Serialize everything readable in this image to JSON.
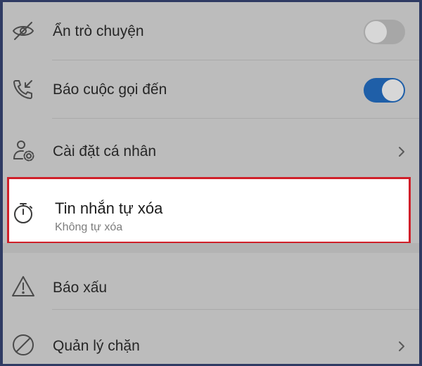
{
  "settings": {
    "items": [
      {
        "icon": "eye-off-icon",
        "label": "Ẩn trò chuyện",
        "control": "toggle",
        "toggle_on": false
      },
      {
        "icon": "incoming-call-icon",
        "label": "Báo cuộc gọi đến",
        "control": "toggle",
        "toggle_on": true
      },
      {
        "icon": "personal-settings-icon",
        "label": "Cài đặt cá nhân",
        "control": "chevron"
      },
      {
        "icon": "timer-icon",
        "label": "Tin nhắn tự xóa",
        "sublabel": "Không tự xóa",
        "highlighted": true
      },
      {
        "icon": "warning-icon",
        "label": "Báo xấu"
      },
      {
        "icon": "block-icon",
        "label": "Quản lý chặn",
        "control": "chevron"
      }
    ]
  },
  "colors": {
    "highlight_border": "#d0202a",
    "toggle_on": "#1f5fa8",
    "overlay_background": "#bcbcbc",
    "page_border": "#2f3b63"
  }
}
